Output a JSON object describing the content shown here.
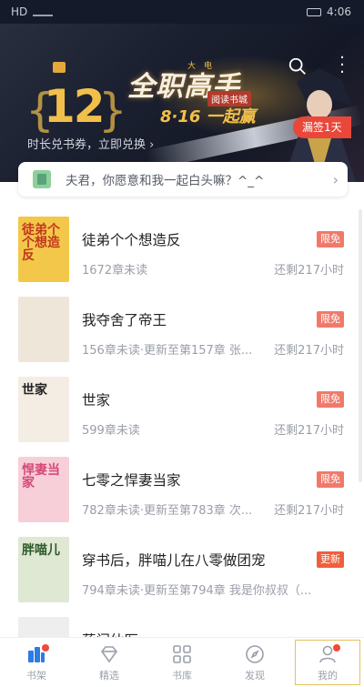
{
  "status_bar": {
    "carrier": "HD",
    "time": "4:06"
  },
  "banner": {
    "small_top": "大　电",
    "days": "12",
    "title": "全职高手",
    "subbrand": "阅读书城",
    "date": "8·16 一起赢",
    "exchange_text": "时长兑书券，立即兑换 ›",
    "checkin_label": "漏签1天"
  },
  "notice": {
    "text": "夫君，你愿意和我一起白头嘛？^_^"
  },
  "books": [
    {
      "title": "徒弟个个想造反",
      "meta": "1672章未读",
      "remain": "还剩217小时",
      "tag": "限免",
      "tag_type": "free",
      "cover_text": "徒弟个个想造反",
      "cover_bg": "#f3c84a",
      "cover_fg": "#c2361f"
    },
    {
      "title": "我夺舍了帝王",
      "meta": "156章未读·更新至第157章 张...",
      "remain": "还剩217小时",
      "tag": "限免",
      "tag_type": "free",
      "cover_text": "",
      "cover_bg": "#efe6da",
      "cover_fg": "#2a2a2a"
    },
    {
      "title": "世家",
      "meta": "599章未读",
      "remain": "还剩217小时",
      "tag": "限免",
      "tag_type": "free",
      "cover_text": "世家",
      "cover_bg": "#f4ede4",
      "cover_fg": "#222222"
    },
    {
      "title": "七零之悍妻当家",
      "meta": "782章未读·更新至第783章 次...",
      "remain": "还剩217小时",
      "tag": "限免",
      "tag_type": "free",
      "cover_text": "悍妻当家",
      "cover_bg": "#f7cfd8",
      "cover_fg": "#d54a7a"
    },
    {
      "title": "穿书后，胖喵儿在八零做团宠",
      "meta": "794章未读·更新至第794章 我是你叔叔（...",
      "remain": "",
      "tag": "更新",
      "tag_type": "update",
      "cover_text": "胖喵儿",
      "cover_bg": "#dfe8d2",
      "cover_fg": "#2e5a2a"
    },
    {
      "title": "药门仙医",
      "meta": "",
      "remain": "",
      "tag": "",
      "tag_type": "update",
      "cover_text": "",
      "cover_bg": "#eeeeee",
      "cover_fg": "#333333"
    }
  ],
  "nav": [
    {
      "label": "书架",
      "icon": "bookshelf-icon",
      "active": true
    },
    {
      "label": "精选",
      "icon": "diamond-icon",
      "active": false
    },
    {
      "label": "书库",
      "icon": "grid-icon",
      "active": false
    },
    {
      "label": "发现",
      "icon": "compass-icon",
      "active": false
    },
    {
      "label": "我的",
      "icon": "person-icon",
      "active": false
    }
  ],
  "colors": {
    "accent": "#2d7be5",
    "tag_free": "#f07a6a",
    "tag_update": "#ef5f3c",
    "gold": "#f2c04a"
  }
}
